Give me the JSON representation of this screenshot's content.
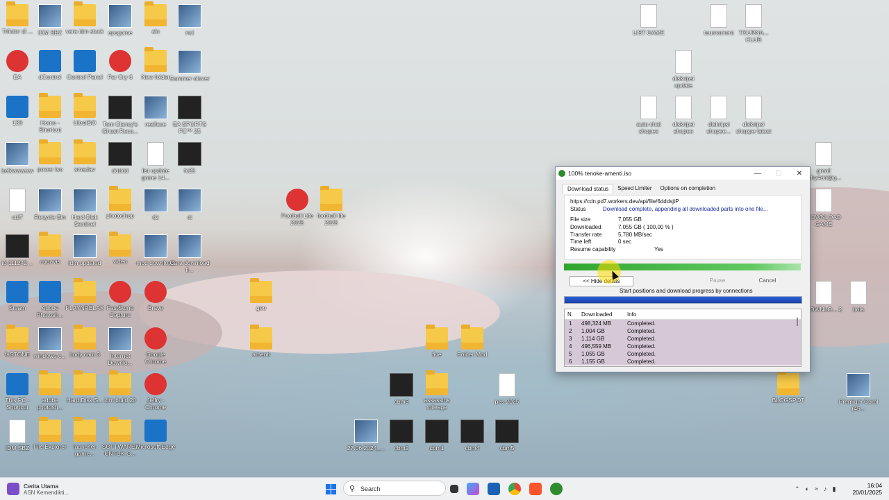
{
  "desktop_icons": [
    {
      "label": "Trfictor dl ...",
      "type": "folder"
    },
    {
      "label": "IDM SBZ",
      "type": "img"
    },
    {
      "label": "vara idm stuck",
      "type": "folder"
    },
    {
      "label": "epsgame",
      "type": "img"
    },
    {
      "label": "alo",
      "type": "folder"
    },
    {
      "label": "md",
      "type": "img"
    },
    {
      "label": "EA",
      "type": "red"
    },
    {
      "label": "dControl",
      "type": "blue"
    },
    {
      "label": "Control Panel",
      "type": "blue"
    },
    {
      "label": "Far Cry 6",
      "type": "red"
    },
    {
      "label": "New folder",
      "type": "folder"
    },
    {
      "label": "Summer olover",
      "type": "img"
    },
    {
      "label": "130",
      "type": "blue"
    },
    {
      "label": "Home - Shortcut",
      "type": "folder"
    },
    {
      "label": "UltraISO",
      "type": "folder"
    },
    {
      "label": "Tom Clancy's Ghost Reco...",
      "type": "dark"
    },
    {
      "label": "realface",
      "type": "img"
    },
    {
      "label": "EA SPORTS FC™ 25",
      "type": "dark"
    },
    {
      "label": "belkwwwww",
      "type": "img"
    },
    {
      "label": "power iso",
      "type": "folder"
    },
    {
      "label": "smadav",
      "type": "folder"
    },
    {
      "label": "ddddd",
      "type": "dark"
    },
    {
      "label": "list update game 14...",
      "type": "doc"
    },
    {
      "label": "fc25",
      "type": "dark"
    },
    {
      "label": "cdl7",
      "type": "doc"
    },
    {
      "label": "Recycle Bin",
      "type": "img"
    },
    {
      "label": "Hard Disk Sentinel",
      "type": "img"
    },
    {
      "label": "photoshop",
      "type": "folder"
    },
    {
      "label": "dz",
      "type": "img"
    },
    {
      "label": "ct",
      "type": "img"
    },
    {
      "label": "id-111242…",
      "type": "dark"
    },
    {
      "label": "aquavis",
      "type": "folder"
    },
    {
      "label": "idm updated",
      "type": "img"
    },
    {
      "label": "video",
      "type": "folder"
    },
    {
      "label": "mod download",
      "type": "img"
    },
    {
      "label": "Cara download fi...",
      "type": "img"
    },
    {
      "label": "Steam",
      "type": "blue"
    },
    {
      "label": "Adobe Photosh...",
      "type": "blue"
    },
    {
      "label": "PLAYNRELAX",
      "type": "folder"
    },
    {
      "label": "FastStone Capture",
      "type": "red"
    },
    {
      "label": "Brave",
      "type": "red"
    },
    {
      "label": "faSTONE",
      "type": "folder"
    },
    {
      "label": "windows-c...",
      "type": "img"
    },
    {
      "label": "body cam 3",
      "type": "folder"
    },
    {
      "label": "Internet Downlo...",
      "type": "img"
    },
    {
      "label": "Google Chrome",
      "type": "red"
    },
    {
      "label": "This PC - Shortcut",
      "type": "blue"
    },
    {
      "label": "adobe photosh...",
      "type": "folder"
    },
    {
      "label": "Hard.Disk.S...",
      "type": "folder"
    },
    {
      "label": "idm build 20",
      "type": "folder"
    },
    {
      "label": "Jeffry - Chrome",
      "type": "red"
    },
    {
      "label": "IDM SBZ",
      "type": "doc"
    },
    {
      "label": "File Explorer",
      "type": "folder"
    },
    {
      "label": "launcher game...",
      "type": "folder"
    },
    {
      "label": "SOFTWARE2 UNTUK G...",
      "type": "folder"
    },
    {
      "label": "Microsoft Edge",
      "type": "blue"
    },
    {
      "label": "Football Life 2025",
      "type": "red"
    },
    {
      "label": "football life 2025",
      "type": "folder"
    },
    {
      "label": "geo",
      "type": "folder"
    },
    {
      "label": "amenti",
      "type": "folder"
    },
    {
      "label": "five",
      "type": "folder"
    },
    {
      "label": "Folder Mod",
      "type": "folder"
    },
    {
      "label": "cbm3",
      "type": "dark"
    },
    {
      "label": "assassins mileage",
      "type": "folder"
    },
    {
      "label": "pes 2025",
      "type": "doc"
    },
    {
      "label": "27.06.2024_...",
      "type": "img"
    },
    {
      "label": "cbm2",
      "type": "dark"
    },
    {
      "label": "cbm1",
      "type": "dark"
    },
    {
      "label": "cbm4",
      "type": "dark"
    },
    {
      "label": "cbm5",
      "type": "dark"
    },
    {
      "label": "LIST GAME",
      "type": "doc"
    },
    {
      "label": "tournament",
      "type": "doc"
    },
    {
      "label": "TOURNA... CLUB",
      "type": "doc"
    },
    {
      "label": "diskripsi update",
      "type": "doc"
    },
    {
      "label": "auto chat shopee",
      "type": "doc"
    },
    {
      "label": "diskripsi shopee",
      "type": "doc"
    },
    {
      "label": "diskripsi shopee...",
      "type": "doc"
    },
    {
      "label": "diskripsi shoppe latest",
      "type": "doc"
    },
    {
      "label": "gmail jefry4dd@g...",
      "type": "doc"
    },
    {
      "label": "DOWNLOAD GAME",
      "type": "doc"
    },
    {
      "label": "DOWNLO... 2",
      "type": "doc"
    },
    {
      "label": "bola",
      "type": "doc"
    },
    {
      "label": "BLOGSPOT",
      "type": "folder"
    },
    {
      "label": "Premium Coral (45...",
      "type": "img"
    }
  ],
  "dialog": {
    "title": "100% tenoke-amenti.iso",
    "tabs": [
      "Download status",
      "Speed Limiter",
      "Options on completion"
    ],
    "url": "https://cdn.pd7.workers.dev/api/file/6dddsjtP",
    "status_label": "Status",
    "status_value": "Download complete, appending all downloaded parts into one file...",
    "file_size_label": "File size",
    "file_size_value": "7,055  GB",
    "downloaded_label": "Downloaded",
    "downloaded_value": "7,055  GB  ( 100,00 % )",
    "transfer_rate_label": "Transfer rate",
    "transfer_rate_value": "5,780  MB/sec",
    "time_left_label": "Time left",
    "time_left_value": "0 sec",
    "resume_label": "Resume capability",
    "resume_value": "Yes",
    "progress": 1.0,
    "hide_details_label": "<< Hide details",
    "pause_label": "Pause",
    "cancel_label": "Cancel",
    "connections_caption": "Start positions and download progress by connections",
    "table_headers": [
      "N.",
      "Downloaded",
      "Info"
    ],
    "table_rows": [
      {
        "n": "1",
        "downloaded": "498,324  MB",
        "info": "Completed."
      },
      {
        "n": "2",
        "downloaded": "1,004  GB",
        "info": "Completed."
      },
      {
        "n": "3",
        "downloaded": "1,114  GB",
        "info": "Completed."
      },
      {
        "n": "4",
        "downloaded": "496,559  MB",
        "info": "Completed."
      },
      {
        "n": "5",
        "downloaded": "1,055  GB",
        "info": "Completed."
      },
      {
        "n": "6",
        "downloaded": "1,155  GB",
        "info": "Completed."
      }
    ]
  },
  "taskbar": {
    "news_title": "Cerita Utama",
    "news_subtitle": "ASN Kemendikti...",
    "search_placeholder": "Search",
    "time": "16:04",
    "date": "20/01/2025"
  }
}
